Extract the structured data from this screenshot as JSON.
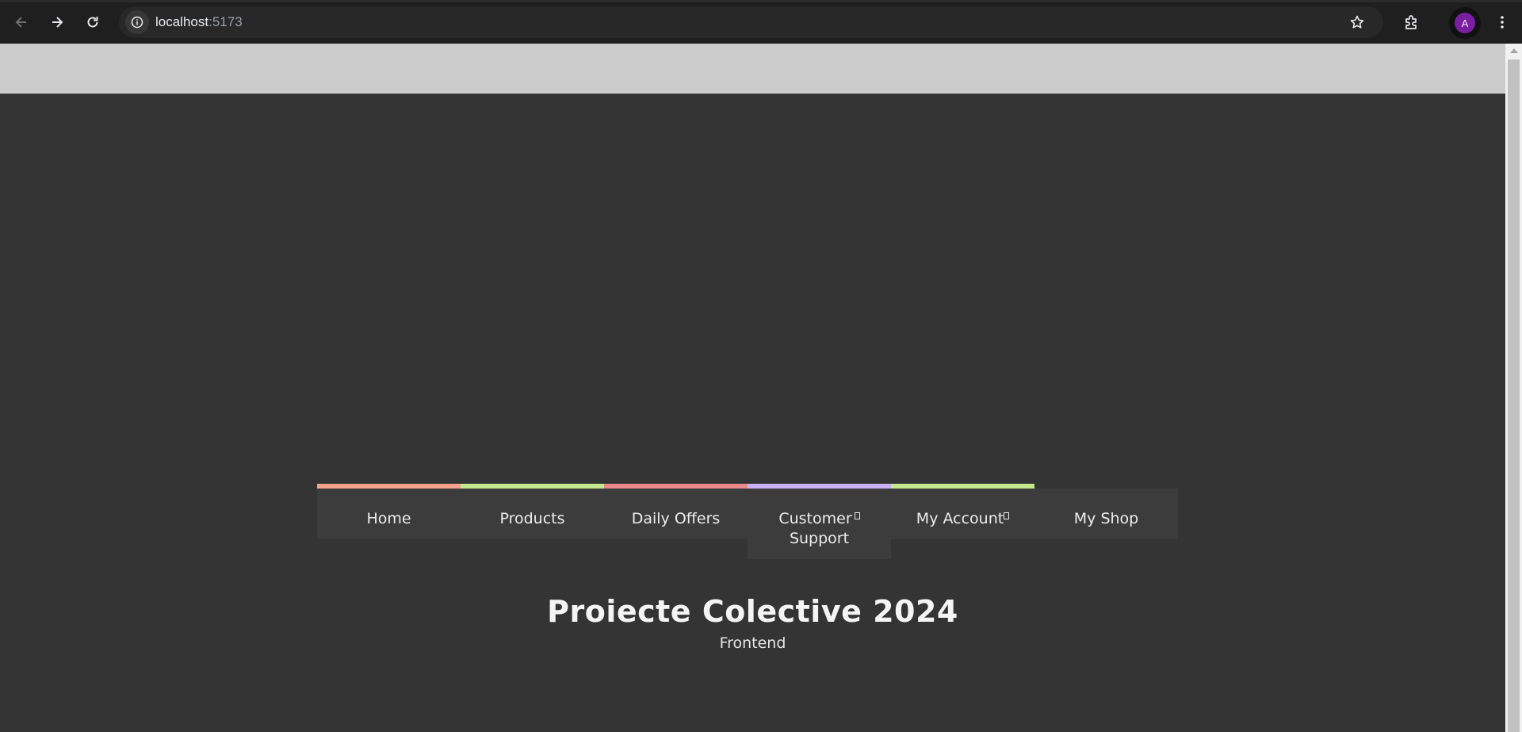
{
  "browser": {
    "url_host": "localhost",
    "url_port": ":5173",
    "profile_initial": "A",
    "icons": [
      "back-arrow-icon",
      "forward-arrow-icon",
      "reload-icon",
      "info-icon",
      "star-icon",
      "extensions-icon",
      "kebab-menu-icon"
    ]
  },
  "nav": {
    "items": [
      {
        "label": "Home",
        "accent": "#f5a38c"
      },
      {
        "label": "Products",
        "accent": "#c3e88d"
      },
      {
        "label": "Daily Offers",
        "accent": "#e88a8a"
      },
      {
        "label": "Customer Support",
        "label_line1": "Customer",
        "label_line2": "Support",
        "accent": "#c7b2f5",
        "has_dropdown": true
      },
      {
        "label": "My Account",
        "accent": "#c3e88d",
        "has_dropdown": true
      },
      {
        "label": "My Shop",
        "accent": null
      }
    ]
  },
  "hero": {
    "title": "Proiecte Colective 2024",
    "subtitle": "Frontend"
  },
  "colors": {
    "page_bg": "#343434",
    "topbar_bg": "#cccccc",
    "menu_bg": "#3c3c3c",
    "avatar_bg": "#7a1fa2"
  }
}
